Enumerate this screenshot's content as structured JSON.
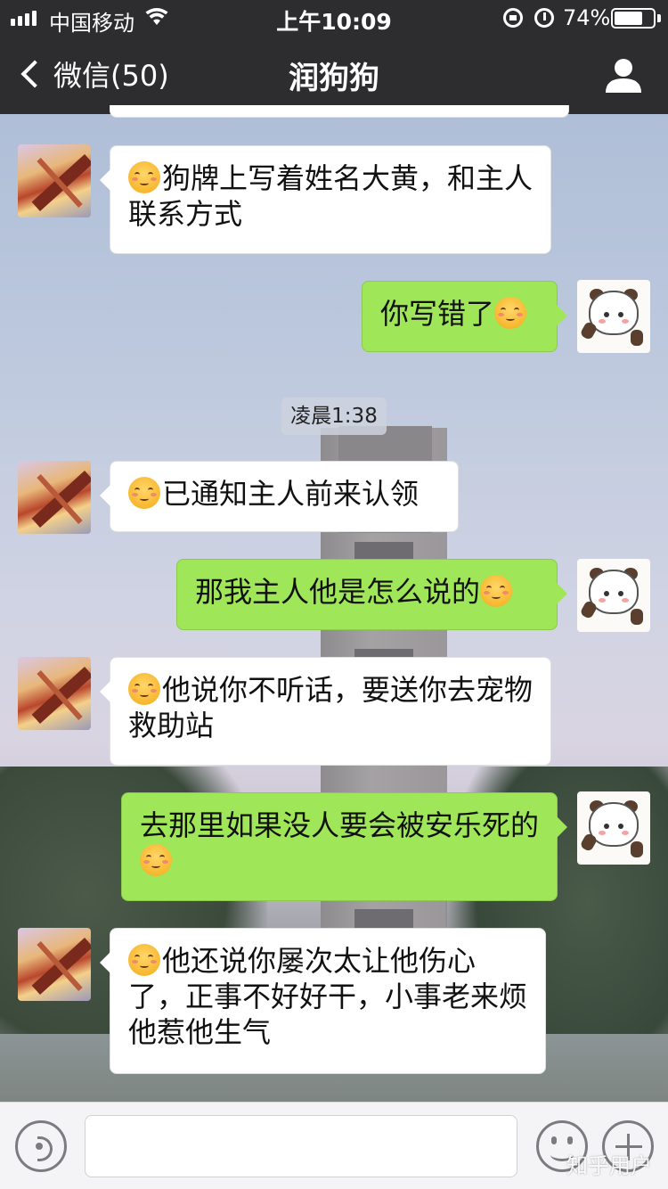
{
  "status_bar": {
    "carrier": "中国移动",
    "time": "上午10:09",
    "battery_percent": "74%",
    "battery_level": 0.74
  },
  "nav": {
    "back_label": "微信(50)",
    "title": "润狗狗"
  },
  "timestamp": "凌晨1:38",
  "messages": [
    {
      "side": "left",
      "text": "狗牌上写着姓名大黄，和主人联系方式",
      "emoji": "smiling-face-emoji"
    },
    {
      "side": "right",
      "text": "你写错了",
      "emoji": "smiling-face-emoji"
    },
    {
      "side": "left",
      "text": "已通知主人前来认领",
      "emoji": "smiling-face-emoji"
    },
    {
      "side": "right",
      "text": "那我主人他是怎么说的",
      "emoji": "smiling-face-emoji"
    },
    {
      "side": "left",
      "text": "他说你不听话，要送你去宠物救助站",
      "emoji": "smiling-face-emoji"
    },
    {
      "side": "right",
      "text": "去那里如果没人要会被安乐死的",
      "emoji": "smiling-face-emoji"
    },
    {
      "side": "left",
      "text": "他还说你屡次太让他伤心了，正事不好好干，小事老来烦他惹他生气",
      "emoji": "smiling-face-emoji"
    }
  ],
  "input_bar": {
    "text_value": "",
    "icons": [
      "voice-icon",
      "emoji-icon",
      "plus-icon"
    ]
  },
  "watermark": "知乎用户",
  "colors": {
    "nav_background": "#2d2d30",
    "outgoing_bubble": "#9fe658",
    "incoming_bubble": "#ffffff"
  }
}
